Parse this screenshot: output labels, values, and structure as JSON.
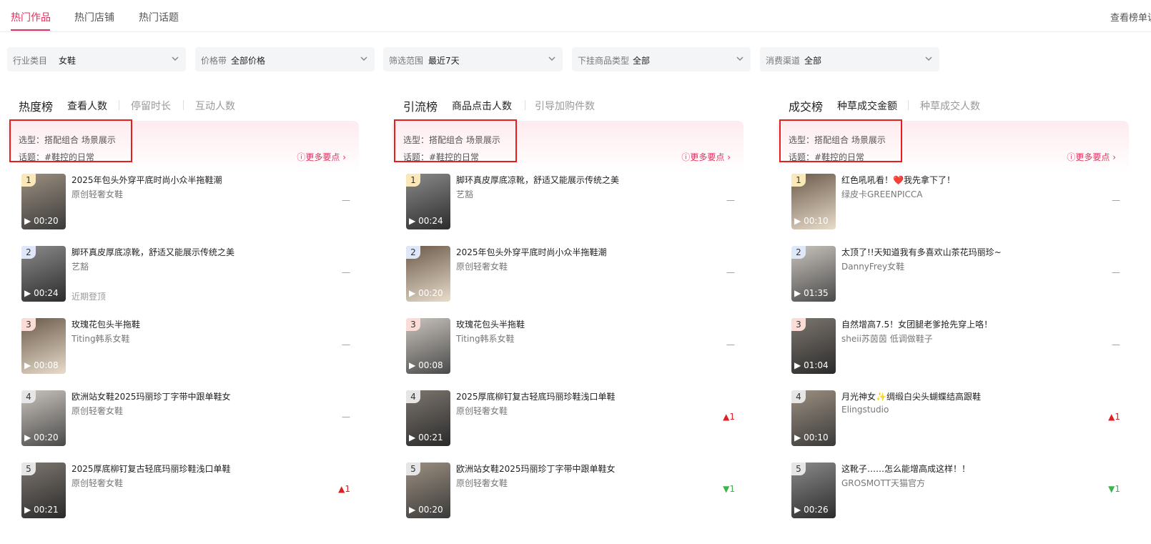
{
  "nav": {
    "tabs": [
      "热门作品",
      "热门店铺",
      "热门话题"
    ],
    "active": 0,
    "right_link": "查看榜单说"
  },
  "filters": [
    {
      "label": "行业类目",
      "value": "女鞋"
    },
    {
      "label": "价格带",
      "value": "全部价格"
    },
    {
      "label": "筛选范围",
      "value": "最近7天"
    },
    {
      "label": "下挂商品类型",
      "value": "全部"
    },
    {
      "label": "消费渠道",
      "value": "全部"
    }
  ],
  "panels": [
    {
      "title": "热度榜",
      "tabs": [
        "查看人数",
        "停留时长",
        "互动人数"
      ],
      "tip_type": "选型：搭配组合 场景展示",
      "tip_topic": "话题：#鞋控的日常",
      "more": "更多要点",
      "items": [
        {
          "rank": "1",
          "duration": "00:20",
          "title": "2025年包头外穿平底时尚小众半拖鞋潮",
          "author": "原创轻奢女鞋",
          "note": "",
          "change": "—",
          "dir": "flat"
        },
        {
          "rank": "2",
          "duration": "00:24",
          "title": "脚环真皮厚底凉靴，舒适又能展示传统之美",
          "author": "艺豁",
          "note": "近期登顶",
          "change": "—",
          "dir": "flat"
        },
        {
          "rank": "3",
          "duration": "00:08",
          "title": "玫瑰花包头半拖鞋",
          "author": "Titing韩系女鞋",
          "note": "",
          "change": "—",
          "dir": "flat"
        },
        {
          "rank": "4",
          "duration": "00:20",
          "title": "欧洲站女鞋2025玛丽珍丁字带中跟单鞋女",
          "author": "原创轻奢女鞋",
          "note": "",
          "change": "—",
          "dir": "flat"
        },
        {
          "rank": "5",
          "duration": "00:21",
          "title": "2025厚底柳钉复古轻底玛丽珍鞋浅口单鞋",
          "author": "原创轻奢女鞋",
          "note": "",
          "change": "▲1",
          "dir": "up"
        }
      ]
    },
    {
      "title": "引流榜",
      "tabs": [
        "商品点击人数",
        "引导加购件数"
      ],
      "tip_type": "选型：搭配组合 场景展示",
      "tip_topic": "话题：#鞋控的日常",
      "more": "更多要点",
      "items": [
        {
          "rank": "1",
          "duration": "00:24",
          "title": "脚环真皮厚底凉靴，舒适又能展示传统之美",
          "author": "艺豁",
          "note": "",
          "change": "—",
          "dir": "flat"
        },
        {
          "rank": "2",
          "duration": "00:20",
          "title": "2025年包头外穿平底时尚小众半拖鞋潮",
          "author": "原创轻奢女鞋",
          "note": "",
          "change": "—",
          "dir": "flat"
        },
        {
          "rank": "3",
          "duration": "00:08",
          "title": "玫瑰花包头半拖鞋",
          "author": "Titing韩系女鞋",
          "note": "",
          "change": "—",
          "dir": "flat"
        },
        {
          "rank": "4",
          "duration": "00:21",
          "title": "2025厚底柳钉复古轻底玛丽珍鞋浅口单鞋",
          "author": "原创轻奢女鞋",
          "note": "",
          "change": "▲1",
          "dir": "up"
        },
        {
          "rank": "5",
          "duration": "00:20",
          "title": "欧洲站女鞋2025玛丽珍丁字带中跟单鞋女",
          "author": "原创轻奢女鞋",
          "note": "",
          "change": "▼1",
          "dir": "down"
        }
      ]
    },
    {
      "title": "成交榜",
      "tabs": [
        "种草成交金额",
        "种草成交人数"
      ],
      "tip_type": "选型：搭配组合 场景展示",
      "tip_topic": "话题：#鞋控的日常",
      "more": "更多要点",
      "items": [
        {
          "rank": "1",
          "duration": "00:10",
          "title": "红色吼吼看！❤️我先拿下了！",
          "author": "绿皮卡GREENPICCA",
          "note": "",
          "change": "—",
          "dir": "flat"
        },
        {
          "rank": "2",
          "duration": "01:35",
          "title": "太顶了!!天知道我有多喜欢山茶花玛丽珍~",
          "author": "DannyFrey女鞋",
          "note": "",
          "change": "—",
          "dir": "flat"
        },
        {
          "rank": "3",
          "duration": "01:04",
          "title": "自然增高7.5！女团腿老爹抢先穿上咯！",
          "author": "sheii苏茵茵 低调做鞋子",
          "note": "",
          "change": "—",
          "dir": "flat"
        },
        {
          "rank": "4",
          "duration": "00:10",
          "title": "月光神女✨绸缎白尖头蝴蝶结高跟鞋",
          "author": "Elingstudio",
          "note": "",
          "change": "▲1",
          "dir": "up"
        },
        {
          "rank": "5",
          "duration": "00:26",
          "title": "这靴子……怎么能增高成这样！！",
          "author": "GROSMOTT天猫官方",
          "note": "",
          "change": "▼1",
          "dir": "down"
        }
      ]
    }
  ],
  "colors": {
    "accent": "#e0325c",
    "highlight_border": "#e61e1e",
    "up": "#e02020",
    "down": "#3bb54a",
    "flat": "#999999"
  }
}
